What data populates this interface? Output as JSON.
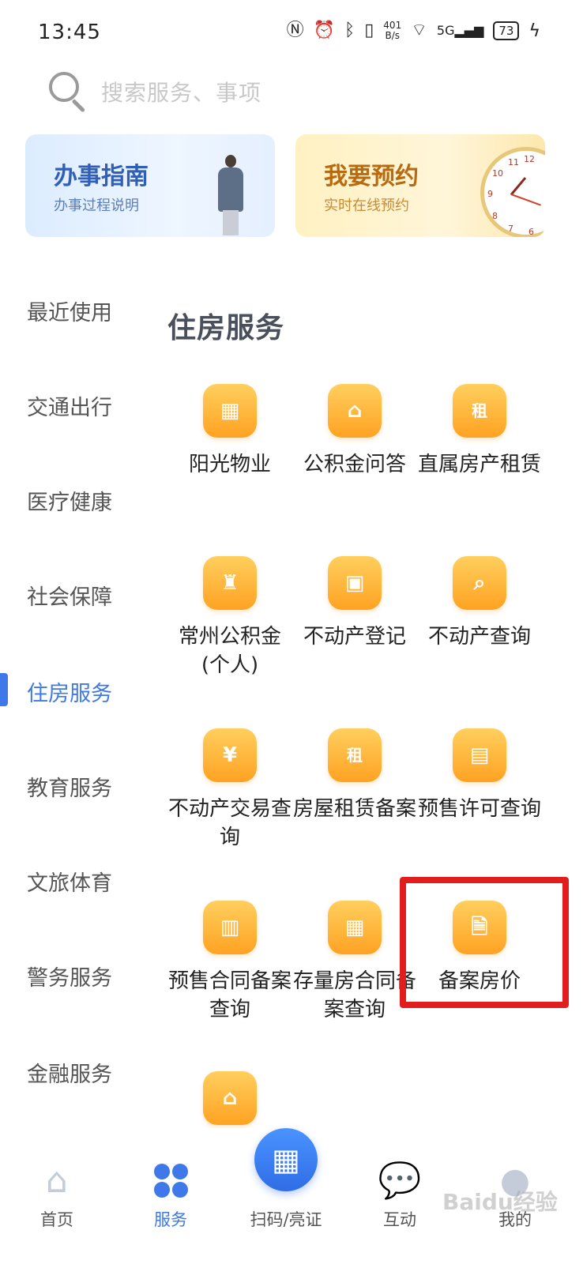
{
  "status_bar": {
    "time": "13:45",
    "net_speed_value": "401",
    "net_speed_unit": "B/s",
    "signal_label": "5G",
    "battery": "73",
    "icons": [
      "nfc-icon",
      "alarm-icon",
      "bluetooth-icon",
      "vibrate-icon",
      "wifi-icon",
      "signal-icon",
      "battery-icon",
      "charging-icon"
    ]
  },
  "search": {
    "placeholder": "搜索服务、事项"
  },
  "banners": [
    {
      "title": "办事指南",
      "subtitle": "办事过程说明"
    },
    {
      "title": "我要预约",
      "subtitle": "实时在线预约"
    }
  ],
  "sidebar": {
    "items": [
      {
        "label": "最近使用"
      },
      {
        "label": "交通出行"
      },
      {
        "label": "医疗健康"
      },
      {
        "label": "社会保障"
      },
      {
        "label": "住房服务"
      },
      {
        "label": "教育服务"
      },
      {
        "label": "文旅体育"
      },
      {
        "label": "警务服务"
      },
      {
        "label": "金融服务"
      }
    ],
    "active": "住房服务"
  },
  "section": {
    "title": "住房服务",
    "services": [
      {
        "label": "阳光物业",
        "icon": "building-icon"
      },
      {
        "label": "公积金问答",
        "icon": "house-medical-icon"
      },
      {
        "label": "直属房产租赁",
        "icon": "rent-house-icon"
      },
      {
        "label": "常州公积金(个人)",
        "icon": "fund-tower-icon"
      },
      {
        "label": "不动产登记",
        "icon": "property-register-icon"
      },
      {
        "label": "不动产查询",
        "icon": "property-search-icon"
      },
      {
        "label": "不动产交易查询",
        "icon": "property-trade-icon"
      },
      {
        "label": "房屋租赁备案",
        "icon": "rent-filing-icon"
      },
      {
        "label": "预售许可查询",
        "icon": "presale-permit-icon"
      },
      {
        "label": "预售合同备案查询",
        "icon": "presale-contract-icon"
      },
      {
        "label": "存量房合同备案查询",
        "icon": "stock-contract-icon"
      },
      {
        "label": "备案房价",
        "icon": "filed-price-icon"
      },
      {
        "label": "",
        "icon": "house-grid-icon"
      }
    ]
  },
  "bottom_nav": {
    "items": [
      {
        "label": "首页",
        "icon": "home-icon"
      },
      {
        "label": "服务",
        "icon": "services-icon"
      },
      {
        "label": "扫码/亮证",
        "icon": "qr-code-icon"
      },
      {
        "label": "互动",
        "icon": "chat-icon"
      },
      {
        "label": "我的",
        "icon": "profile-icon"
      }
    ],
    "active": "服务"
  },
  "watermark": "Baidu经验",
  "colors": {
    "accent": "#3f78e8",
    "service_icon": "#ffb13a",
    "highlight": "#e21d1d"
  }
}
